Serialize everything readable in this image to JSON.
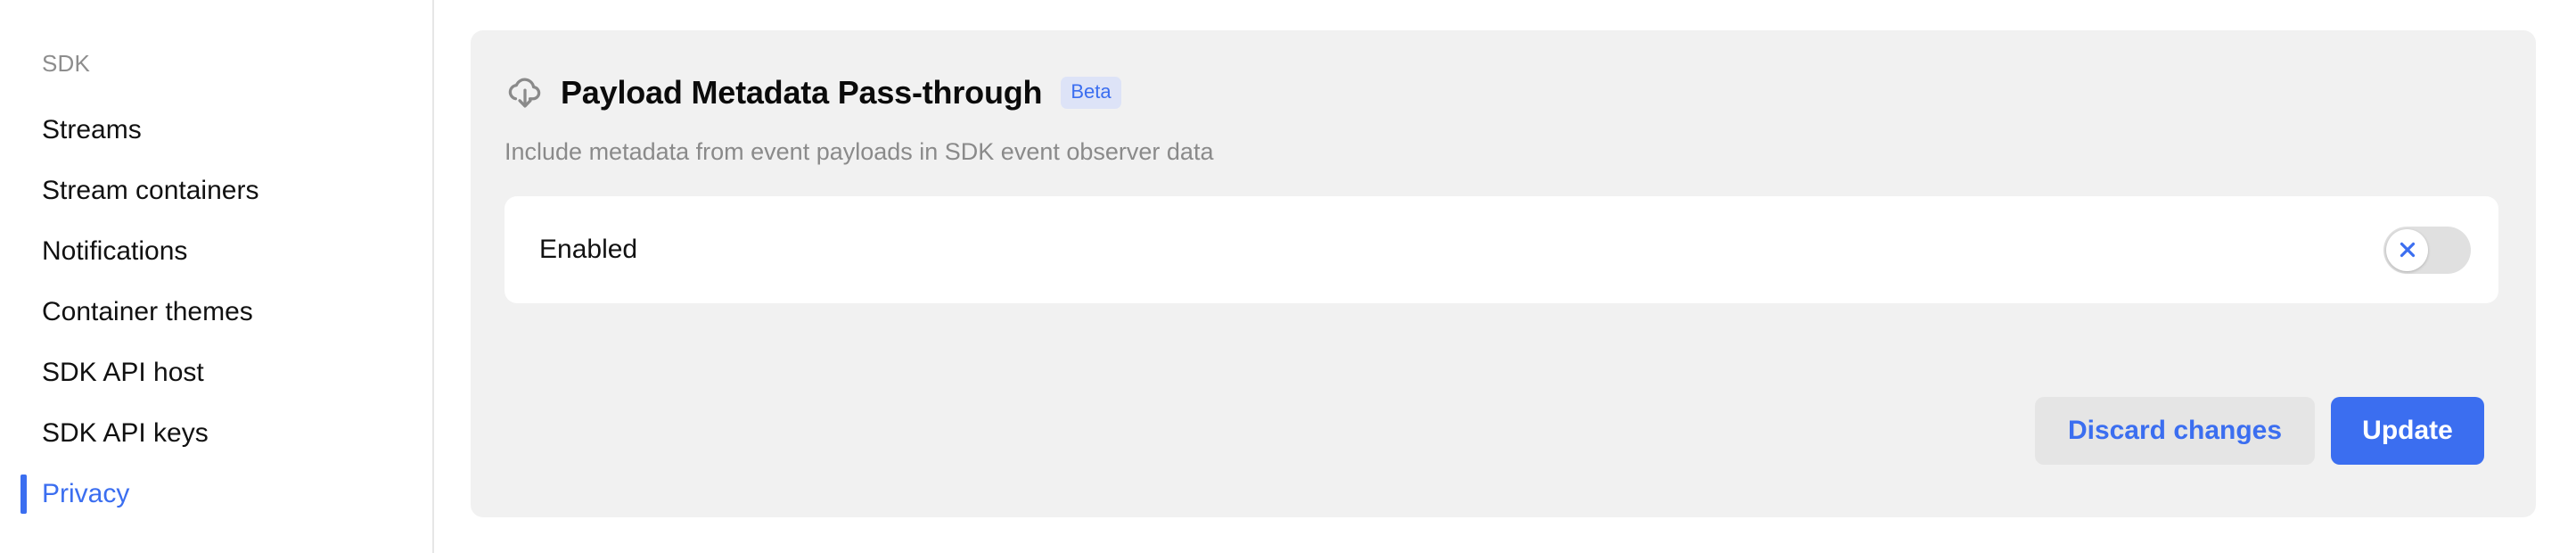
{
  "sidebar": {
    "section_label": "SDK",
    "items": [
      {
        "label": "Streams",
        "active": false
      },
      {
        "label": "Stream containers",
        "active": false
      },
      {
        "label": "Notifications",
        "active": false
      },
      {
        "label": "Container themes",
        "active": false
      },
      {
        "label": "SDK API host",
        "active": false
      },
      {
        "label": "SDK API keys",
        "active": false
      },
      {
        "label": "Privacy",
        "active": true
      }
    ]
  },
  "card": {
    "icon": "cloud-download-icon",
    "title": "Payload Metadata Pass-through",
    "badge": "Beta",
    "subtitle": "Include metadata from event payloads in SDK event observer data",
    "setting": {
      "label": "Enabled",
      "toggle_state": "off",
      "toggle_icon": "close-x-icon"
    },
    "actions": {
      "discard_label": "Discard changes",
      "update_label": "Update"
    }
  },
  "colors": {
    "accent": "#3b6ef0",
    "card_background": "#f1f1f1",
    "badge_background": "#dde3f7",
    "secondary_button_background": "#e5e5e5",
    "toggle_track_off": "#e0e0e0",
    "muted_text": "#8a8a8a"
  }
}
